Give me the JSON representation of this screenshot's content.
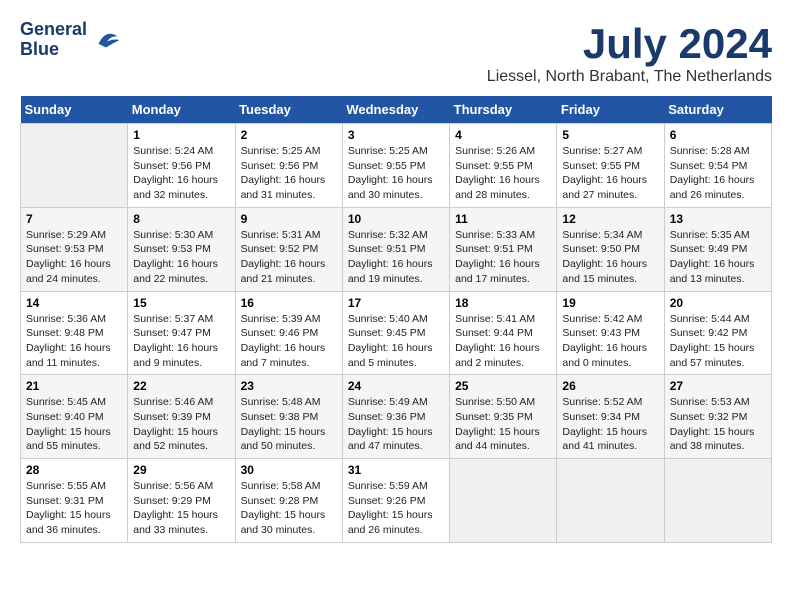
{
  "header": {
    "logo_line1": "General",
    "logo_line2": "Blue",
    "title": "July 2024",
    "subtitle": "Liessel, North Brabant, The Netherlands"
  },
  "calendar": {
    "days_of_week": [
      "Sunday",
      "Monday",
      "Tuesday",
      "Wednesday",
      "Thursday",
      "Friday",
      "Saturday"
    ],
    "weeks": [
      [
        {
          "day": "",
          "info": ""
        },
        {
          "day": "1",
          "info": "Sunrise: 5:24 AM\nSunset: 9:56 PM\nDaylight: 16 hours\nand 32 minutes."
        },
        {
          "day": "2",
          "info": "Sunrise: 5:25 AM\nSunset: 9:56 PM\nDaylight: 16 hours\nand 31 minutes."
        },
        {
          "day": "3",
          "info": "Sunrise: 5:25 AM\nSunset: 9:55 PM\nDaylight: 16 hours\nand 30 minutes."
        },
        {
          "day": "4",
          "info": "Sunrise: 5:26 AM\nSunset: 9:55 PM\nDaylight: 16 hours\nand 28 minutes."
        },
        {
          "day": "5",
          "info": "Sunrise: 5:27 AM\nSunset: 9:55 PM\nDaylight: 16 hours\nand 27 minutes."
        },
        {
          "day": "6",
          "info": "Sunrise: 5:28 AM\nSunset: 9:54 PM\nDaylight: 16 hours\nand 26 minutes."
        }
      ],
      [
        {
          "day": "7",
          "info": "Sunrise: 5:29 AM\nSunset: 9:53 PM\nDaylight: 16 hours\nand 24 minutes."
        },
        {
          "day": "8",
          "info": "Sunrise: 5:30 AM\nSunset: 9:53 PM\nDaylight: 16 hours\nand 22 minutes."
        },
        {
          "day": "9",
          "info": "Sunrise: 5:31 AM\nSunset: 9:52 PM\nDaylight: 16 hours\nand 21 minutes."
        },
        {
          "day": "10",
          "info": "Sunrise: 5:32 AM\nSunset: 9:51 PM\nDaylight: 16 hours\nand 19 minutes."
        },
        {
          "day": "11",
          "info": "Sunrise: 5:33 AM\nSunset: 9:51 PM\nDaylight: 16 hours\nand 17 minutes."
        },
        {
          "day": "12",
          "info": "Sunrise: 5:34 AM\nSunset: 9:50 PM\nDaylight: 16 hours\nand 15 minutes."
        },
        {
          "day": "13",
          "info": "Sunrise: 5:35 AM\nSunset: 9:49 PM\nDaylight: 16 hours\nand 13 minutes."
        }
      ],
      [
        {
          "day": "14",
          "info": "Sunrise: 5:36 AM\nSunset: 9:48 PM\nDaylight: 16 hours\nand 11 minutes."
        },
        {
          "day": "15",
          "info": "Sunrise: 5:37 AM\nSunset: 9:47 PM\nDaylight: 16 hours\nand 9 minutes."
        },
        {
          "day": "16",
          "info": "Sunrise: 5:39 AM\nSunset: 9:46 PM\nDaylight: 16 hours\nand 7 minutes."
        },
        {
          "day": "17",
          "info": "Sunrise: 5:40 AM\nSunset: 9:45 PM\nDaylight: 16 hours\nand 5 minutes."
        },
        {
          "day": "18",
          "info": "Sunrise: 5:41 AM\nSunset: 9:44 PM\nDaylight: 16 hours\nand 2 minutes."
        },
        {
          "day": "19",
          "info": "Sunrise: 5:42 AM\nSunset: 9:43 PM\nDaylight: 16 hours\nand 0 minutes."
        },
        {
          "day": "20",
          "info": "Sunrise: 5:44 AM\nSunset: 9:42 PM\nDaylight: 15 hours\nand 57 minutes."
        }
      ],
      [
        {
          "day": "21",
          "info": "Sunrise: 5:45 AM\nSunset: 9:40 PM\nDaylight: 15 hours\nand 55 minutes."
        },
        {
          "day": "22",
          "info": "Sunrise: 5:46 AM\nSunset: 9:39 PM\nDaylight: 15 hours\nand 52 minutes."
        },
        {
          "day": "23",
          "info": "Sunrise: 5:48 AM\nSunset: 9:38 PM\nDaylight: 15 hours\nand 50 minutes."
        },
        {
          "day": "24",
          "info": "Sunrise: 5:49 AM\nSunset: 9:36 PM\nDaylight: 15 hours\nand 47 minutes."
        },
        {
          "day": "25",
          "info": "Sunrise: 5:50 AM\nSunset: 9:35 PM\nDaylight: 15 hours\nand 44 minutes."
        },
        {
          "day": "26",
          "info": "Sunrise: 5:52 AM\nSunset: 9:34 PM\nDaylight: 15 hours\nand 41 minutes."
        },
        {
          "day": "27",
          "info": "Sunrise: 5:53 AM\nSunset: 9:32 PM\nDaylight: 15 hours\nand 38 minutes."
        }
      ],
      [
        {
          "day": "28",
          "info": "Sunrise: 5:55 AM\nSunset: 9:31 PM\nDaylight: 15 hours\nand 36 minutes."
        },
        {
          "day": "29",
          "info": "Sunrise: 5:56 AM\nSunset: 9:29 PM\nDaylight: 15 hours\nand 33 minutes."
        },
        {
          "day": "30",
          "info": "Sunrise: 5:58 AM\nSunset: 9:28 PM\nDaylight: 15 hours\nand 30 minutes."
        },
        {
          "day": "31",
          "info": "Sunrise: 5:59 AM\nSunset: 9:26 PM\nDaylight: 15 hours\nand 26 minutes."
        },
        {
          "day": "",
          "info": ""
        },
        {
          "day": "",
          "info": ""
        },
        {
          "day": "",
          "info": ""
        }
      ]
    ]
  }
}
